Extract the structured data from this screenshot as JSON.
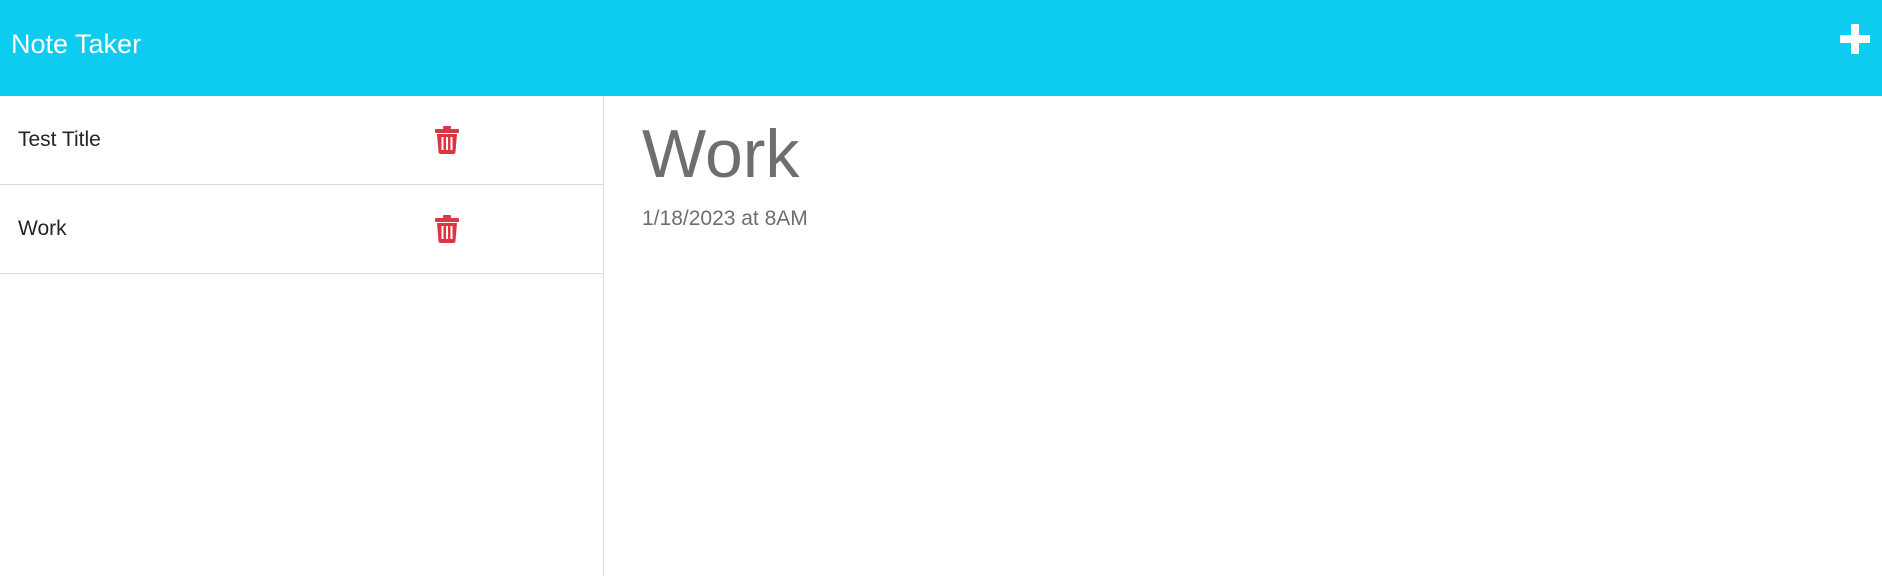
{
  "app": {
    "title": "Note Taker",
    "new_note_icon": "plus-icon"
  },
  "colors": {
    "navbar_bg": "#0ecbf0",
    "delete_icon": "#dc3545",
    "note_text": "#6e6e6e"
  },
  "notes": [
    {
      "title": "Test Title",
      "delete_icon": "trash-icon"
    },
    {
      "title": "Work",
      "delete_icon": "trash-icon"
    }
  ],
  "active_note": {
    "title": "Work",
    "text": "1/18/2023 at 8AM"
  }
}
